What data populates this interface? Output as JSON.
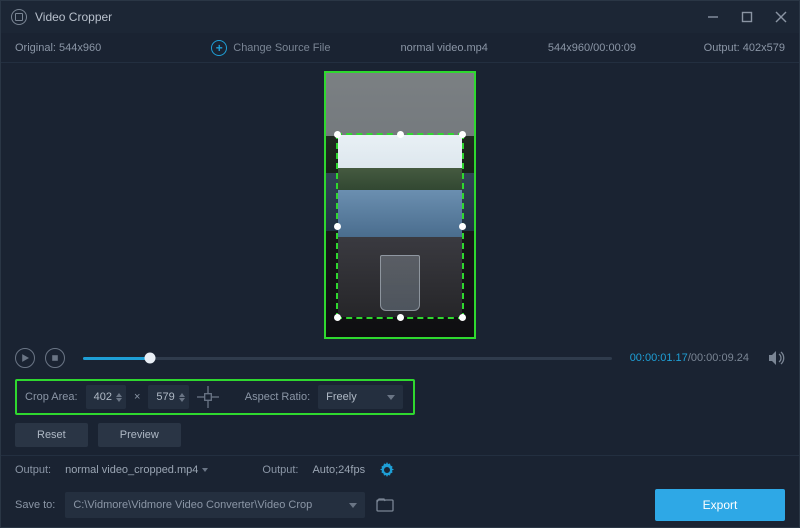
{
  "titlebar": {
    "title": "Video Cropper"
  },
  "info": {
    "original_label": "Original:",
    "original_dims": "544x960",
    "change_source": "Change Source File",
    "filename": "normal video.mp4",
    "src_dims_time": "544x960/00:00:09",
    "output_label": "Output:",
    "output_dims": "402x579"
  },
  "playback": {
    "current": "00:00:01.17",
    "sep": "/",
    "duration": "00:00:09.24"
  },
  "crop": {
    "label": "Crop Area:",
    "w": "402",
    "x": "×",
    "h": "579",
    "aspect_label": "Aspect Ratio:",
    "aspect_value": "Freely"
  },
  "buttons": {
    "reset": "Reset",
    "preview": "Preview"
  },
  "output": {
    "label1": "Output:",
    "filename": "normal video_cropped.mp4",
    "label2": "Output:",
    "settings": "Auto;24fps"
  },
  "save": {
    "label": "Save to:",
    "path": "C:\\Vidmore\\Vidmore Video Converter\\Video Crop"
  },
  "export": {
    "label": "Export"
  }
}
